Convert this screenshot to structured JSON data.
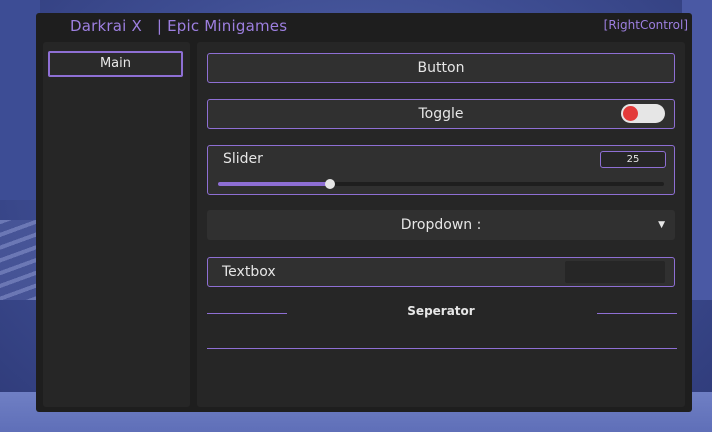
{
  "window": {
    "title": "Darkrai X   | Epic Minigames",
    "keybind": "[RightControl]"
  },
  "tabs": [
    {
      "label": "Main",
      "selected": true
    }
  ],
  "elements": {
    "button": {
      "label": "Button"
    },
    "toggle": {
      "label": "Toggle",
      "state": false,
      "off_color": "#e33b3b"
    },
    "slider": {
      "label": "Slider",
      "value": "25",
      "fraction": 0.25
    },
    "dropdown": {
      "label": "Dropdown :",
      "icon": "caret-down-icon"
    },
    "textbox": {
      "label": "Textbox",
      "value": ""
    },
    "separator": {
      "label": "Seperator"
    }
  },
  "colors": {
    "accent": "#8e6fd4",
    "background": "#1e1e1e",
    "panel": "#262626"
  }
}
